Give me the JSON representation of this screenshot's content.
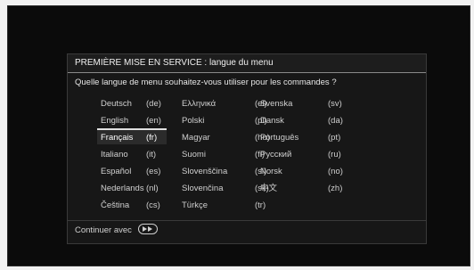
{
  "dialog": {
    "title": "PREMIÈRE MISE EN SERVICE : langue du menu",
    "question": "Quelle langue de menu souhaitez-vous utiliser pour les commandes ?",
    "footer_label": "Continuer avec",
    "footer_icon": "fast-forward-icon",
    "selected": "Français"
  },
  "languages": {
    "col1": [
      {
        "name": "Deutsch",
        "code": "(de)"
      },
      {
        "name": "English",
        "code": "(en)"
      },
      {
        "name": "Français",
        "code": "(fr)"
      },
      {
        "name": "Italiano",
        "code": "(it)"
      },
      {
        "name": "Español",
        "code": "(es)"
      },
      {
        "name": "Nederlands",
        "code": "(nl)"
      },
      {
        "name": "Čeština",
        "code": "(cs)"
      }
    ],
    "col2": [
      {
        "name": "Ελληνικά",
        "code": "(el)"
      },
      {
        "name": "Polski",
        "code": "(pl)"
      },
      {
        "name": "Magyar",
        "code": "(hu)"
      },
      {
        "name": "Suomi",
        "code": "(fi)"
      },
      {
        "name": "Slovenščina",
        "code": "(sl)"
      },
      {
        "name": "Slovenčina",
        "code": "(sk)"
      },
      {
        "name": "Türkçe",
        "code": "(tr)"
      }
    ],
    "col3": [
      {
        "name": "Svenska",
        "code": "(sv)"
      },
      {
        "name": "Dansk",
        "code": "(da)"
      },
      {
        "name": "Português",
        "code": "(pt)"
      },
      {
        "name": "Русский",
        "code": "(ru)"
      },
      {
        "name": "Norsk",
        "code": "(no)"
      },
      {
        "name": "中文",
        "code": "(zh)"
      }
    ]
  }
}
